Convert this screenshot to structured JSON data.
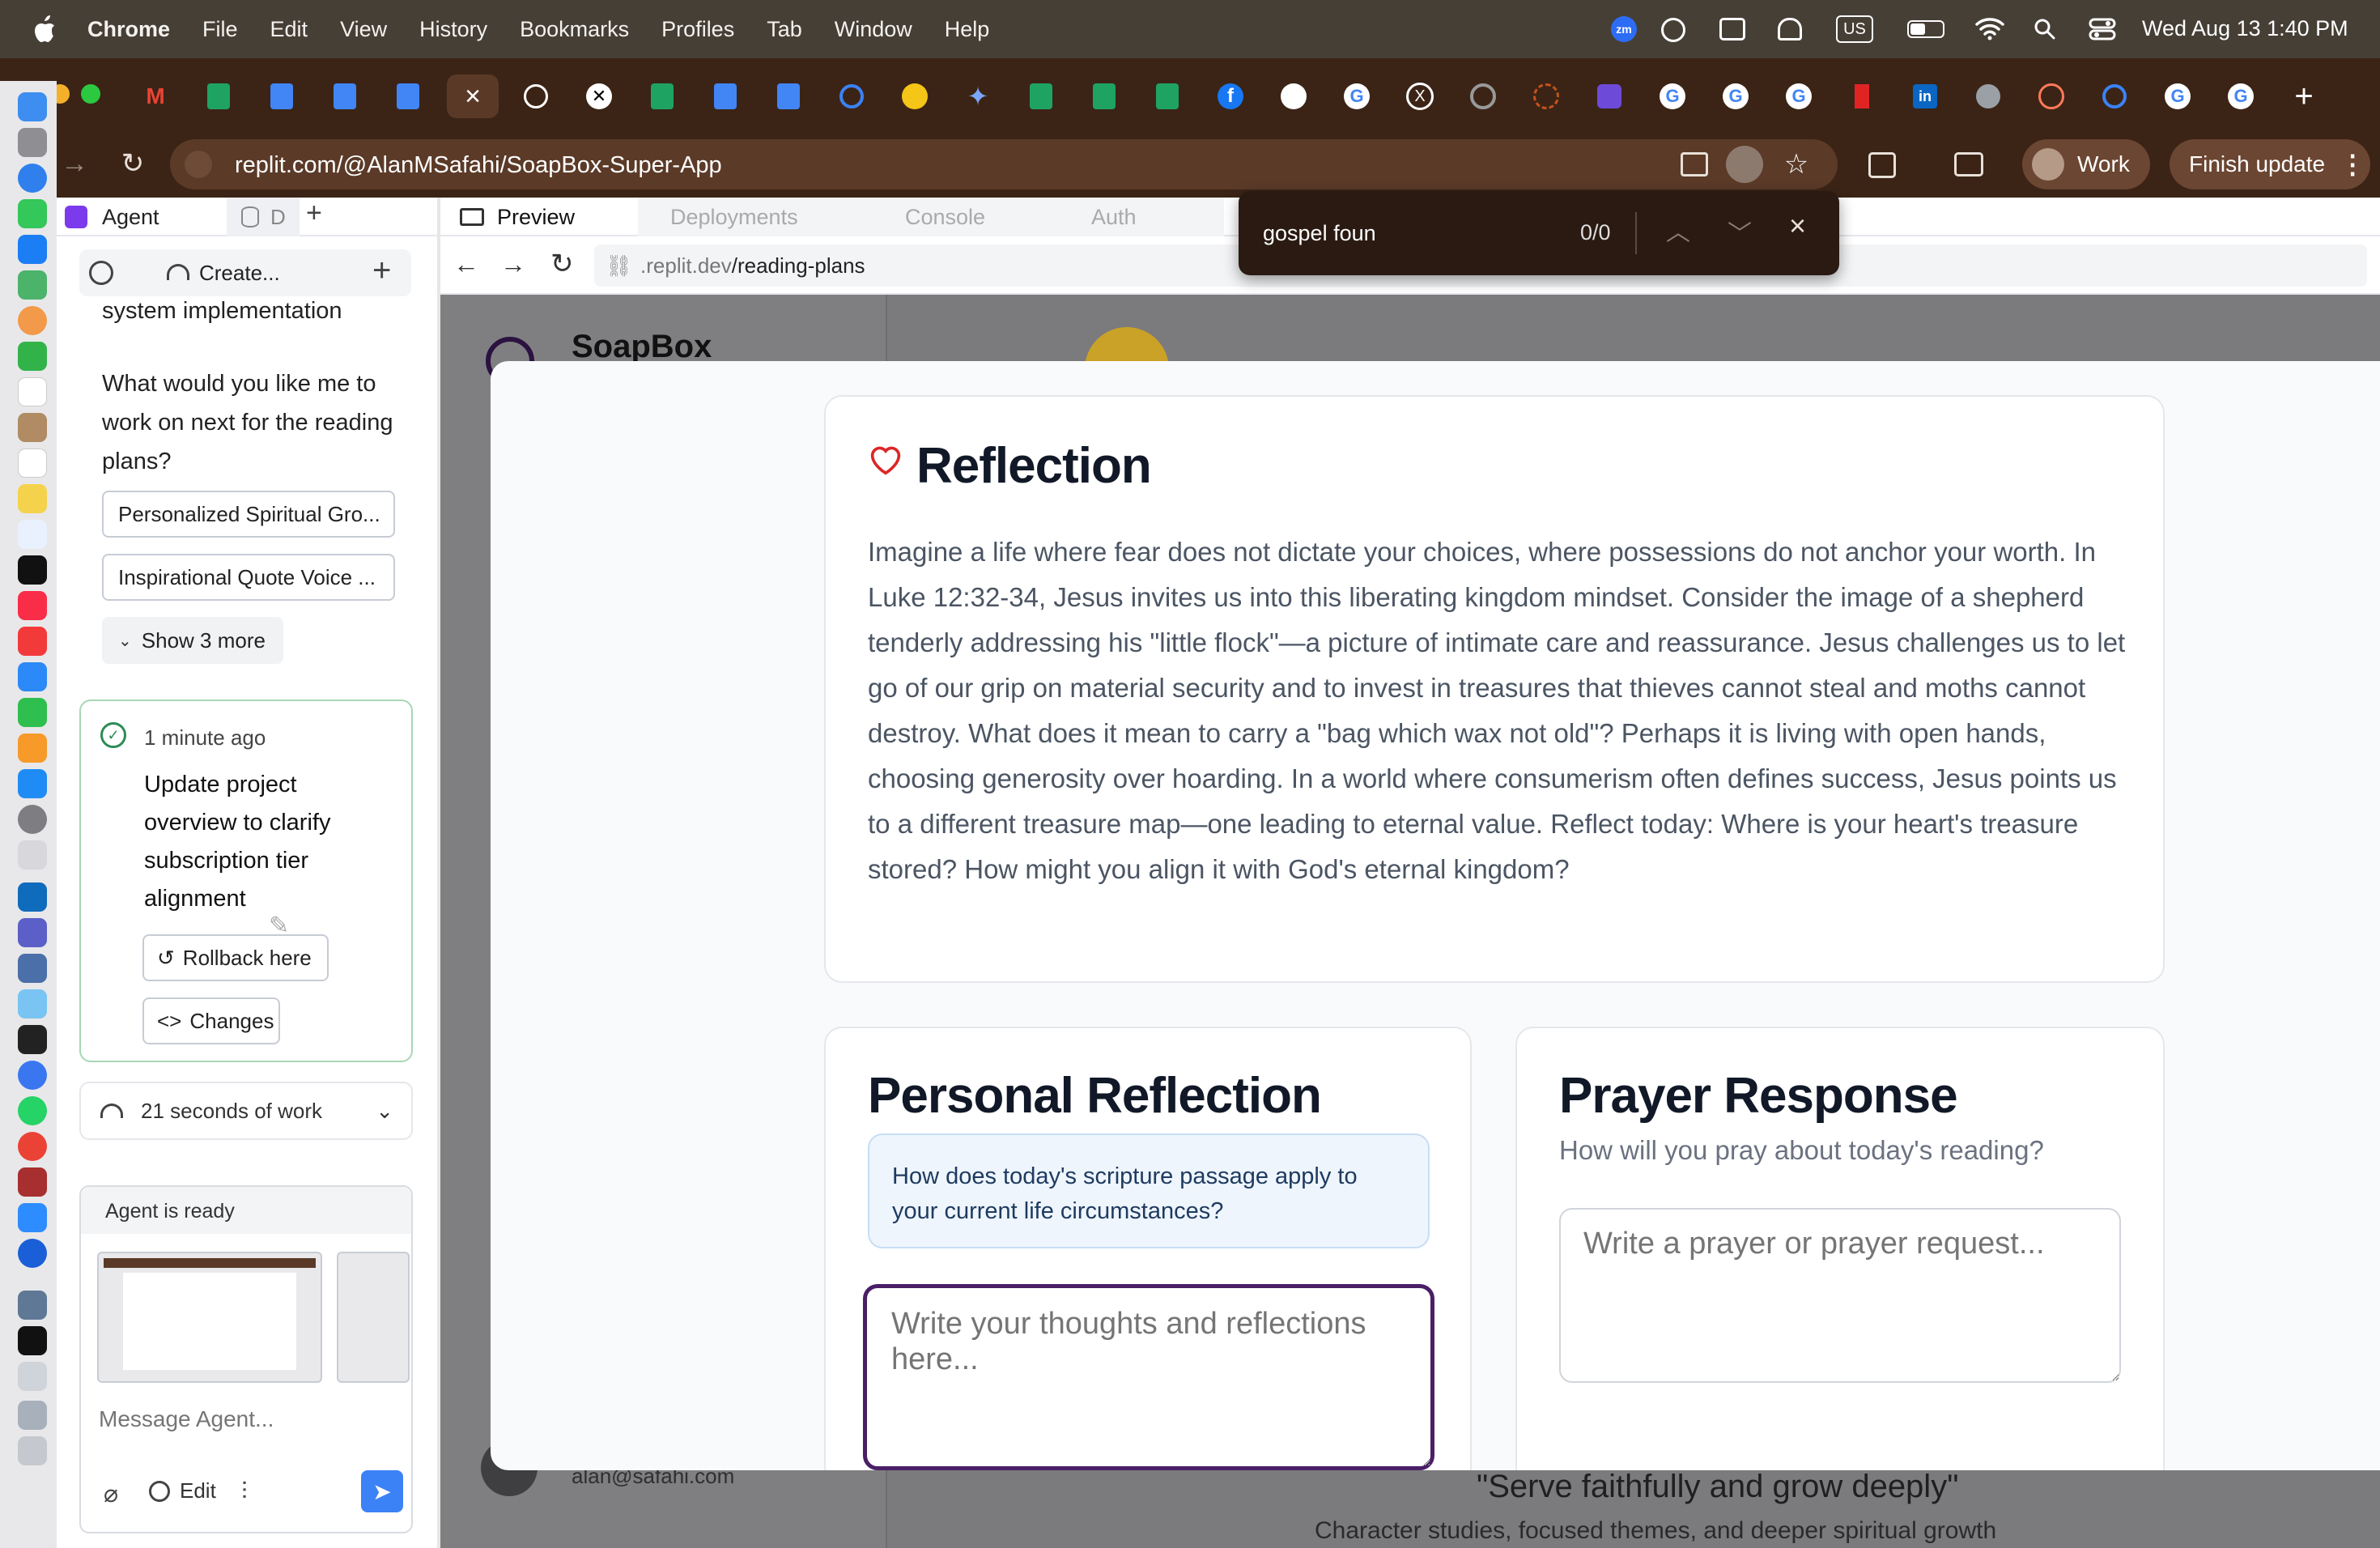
{
  "menubar": {
    "app": "Chrome",
    "items": [
      "File",
      "Edit",
      "View",
      "History",
      "Bookmarks",
      "Profiles",
      "Tab",
      "Window",
      "Help"
    ],
    "status_us": "US",
    "clock": "Wed Aug 13  1:40 PM",
    "zoom_label": "zm"
  },
  "address": {
    "url": "replit.com/@AlanMSafahi/SoapBox-Super-App",
    "profile": "Work",
    "finish_update": "Finish update"
  },
  "find": {
    "query": "gospel foun",
    "count": "0/0"
  },
  "agent": {
    "tab_agent": "Agent",
    "tab_db": "D",
    "create_label": "Create...",
    "text_top": "system implementation",
    "question": "What would you like me to work on next for the reading plans?",
    "suggestions": [
      "Personalized Spiritual Gro...",
      "Inspirational Quote Voice ..."
    ],
    "show_more": "Show 3 more",
    "checkpoint_time": "1 minute ago",
    "checkpoint_title": "Update project overview to clarify subscription tier alignment",
    "rollback": "Rollback here",
    "changes": "Changes",
    "work_time": "21 seconds of work",
    "ready": "Agent is ready",
    "message_placeholder": "Message Agent...",
    "edit": "Edit"
  },
  "workspace": {
    "tabs": [
      "Preview",
      "Deployments",
      "Console",
      "Auth"
    ],
    "preview_url_host": ".replit.dev",
    "preview_url_path": "/reading-plans"
  },
  "app": {
    "brand": "SoapBox",
    "user_email": "alan@safahi.com",
    "tagline": "\"Serve faithfully and grow deeply\"",
    "subtagline": "Character studies, focused themes, and deeper spiritual growth"
  },
  "reflection": {
    "title": "Reflection",
    "body": "Imagine a life where fear does not dictate your choices, where possessions do not anchor your worth. In Luke 12:32-34, Jesus invites us into this liberating kingdom mindset. Consider the image of a shepherd tenderly addressing his \"little flock\"—a picture of intimate care and reassurance. Jesus challenges us to let go of our grip on material security and to invest in treasures that thieves cannot steal and moths cannot destroy. What does it mean to carry a \"bag which wax not old\"? Perhaps it is living with open hands, choosing generosity over hoarding. In a world where consumerism often defines success, Jesus points us to a different treasure map—one leading to eternal value. Reflect today: Where is your heart's treasure stored? How might you align it with God's eternal kingdom?"
  },
  "personal": {
    "title": "Personal Reflection",
    "prompt": "How does today's scripture passage apply to your current life circumstances?",
    "placeholder": "Write your thoughts and reflections here..."
  },
  "prayer": {
    "title": "Prayer Response",
    "subtitle": "How will you pray about today's reading?",
    "placeholder": "Write a prayer or prayer request..."
  },
  "colors": {
    "accent_purple": "#4a1f66",
    "heart": "#dc2626",
    "prompt_bg": "#eef5fd",
    "chrome_tabbar": "#3b2416",
    "menubar": "#463f36"
  }
}
